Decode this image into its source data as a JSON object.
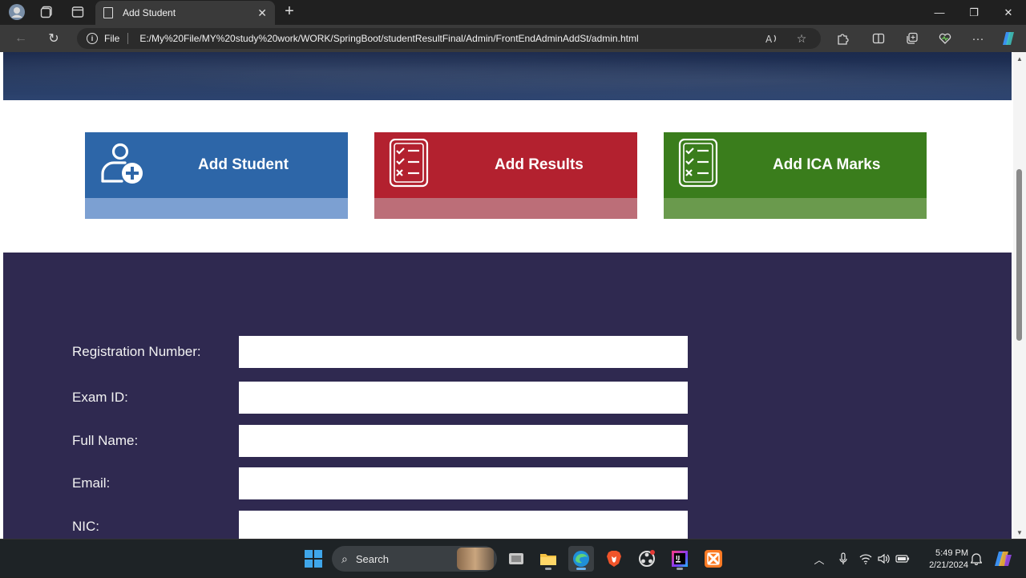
{
  "browser": {
    "tab_title": "Add Student",
    "close_tab": "✕",
    "new_tab": "+",
    "address_scheme_label": "File",
    "url": "E:/My%20File/MY%20study%20work/WORK/SpringBoot/studentResultFinal/Admin/FrontEndAdminAddSt/admin.html",
    "window_controls": {
      "minimize": "—",
      "restore": "❐",
      "close": "✕"
    }
  },
  "page": {
    "cards": [
      {
        "label": "Add Student",
        "icon": "add-user-icon",
        "color": "#2d66a8"
      },
      {
        "label": "Add Results",
        "icon": "checklist-icon",
        "color": "#b3212f"
      },
      {
        "label": "Add ICA Marks",
        "icon": "checklist-icon",
        "color": "#3a7d1c"
      }
    ],
    "form": {
      "fields": [
        {
          "label": "Registration Number:",
          "value": ""
        },
        {
          "label": "Exam ID:",
          "value": ""
        },
        {
          "label": "Full Name:",
          "value": ""
        },
        {
          "label": "Email:",
          "value": ""
        },
        {
          "label": "NIC:",
          "value": ""
        }
      ]
    }
  },
  "taskbar": {
    "search_label": "Search",
    "clock_time": "5:49 PM",
    "clock_date": "2/21/2024"
  },
  "colors": {
    "form_background": "#2f2950",
    "header_background": "#1b2a4d"
  }
}
